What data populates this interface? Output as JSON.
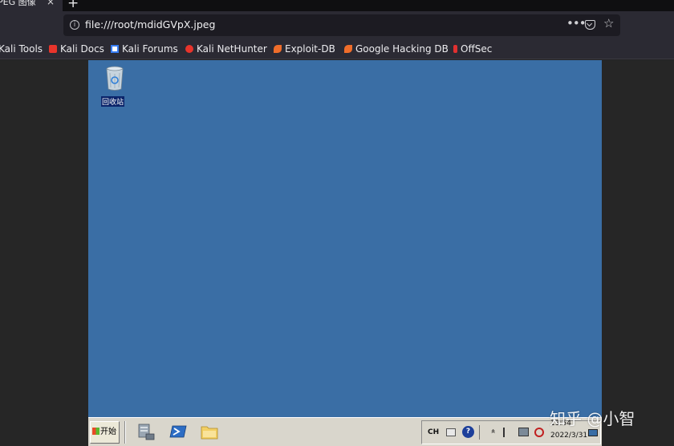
{
  "browser": {
    "tab": {
      "title": "PEG 图像",
      "close": "×"
    },
    "new_tab": "+",
    "url": "file:///root/mdidGVpX.jpeg",
    "more": "•••",
    "star": "☆",
    "bookmarks": [
      {
        "label": "Kali Tools",
        "color": "#367bf0"
      },
      {
        "label": "Kali Docs",
        "color": "#e8342b"
      },
      {
        "label": "Kali Forums",
        "color": "#367bf0"
      },
      {
        "label": "Kali NetHunter",
        "color": "#e8342b"
      },
      {
        "label": "Exploit-DB",
        "color": "#ef6d2a"
      },
      {
        "label": "Google Hacking DB",
        "color": "#ef6d2a"
      },
      {
        "label": "OffSec",
        "color": "#e03030"
      }
    ]
  },
  "desktop": {
    "background": "#3a6ea5",
    "icons": [
      {
        "label": "回收站"
      }
    ]
  },
  "taskbar": {
    "start_label": "开始",
    "tray": {
      "ime": "CH",
      "help": "?",
      "chevron": "»",
      "time": "13:54",
      "date": "2022/3/31"
    }
  },
  "watermark": "知乎 @小智"
}
